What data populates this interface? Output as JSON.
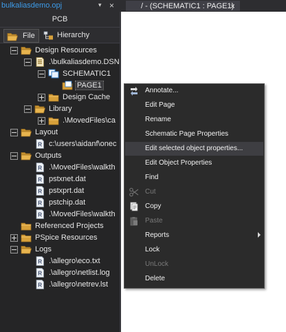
{
  "top": {
    "project_tab_title": "bulkaliasdemo.opj",
    "pin_icon": "▾",
    "close_icon": "×",
    "doc_tab_title": "/ - (SCHEMATIC1 : PAGE1)"
  },
  "panel": {
    "pcb_label": "PCB",
    "tabs": {
      "file": "File",
      "hierarchy": "Hierarchy"
    }
  },
  "tree": {
    "design_resources": "Design Resources",
    "dsn": ".\\bulkaliasdemo.DSN",
    "schematic1": "SCHEMATIC1",
    "page1": "PAGE1",
    "design_cache": "Design Cache",
    "library": "Library",
    "movedfiles_ca": ".\\MovedFiles\\ca",
    "layout": "Layout",
    "layout_path": "c:\\users\\aidanf\\onec",
    "outputs": "Outputs",
    "outputs_movedfiles_walkth": ".\\MovedFiles\\walkth",
    "pstxnet": "pstxnet.dat",
    "pstxprt": "pstxprt.dat",
    "pstchip": "pstchip.dat",
    "outputs_movedfiles_walkth2": ".\\MovedFiles\\walkth",
    "referenced_projects": "Referenced Projects",
    "pspice_resources": "PSpice Resources",
    "logs": "Logs",
    "eco": ".\\allegro\\eco.txt",
    "netlist": ".\\allegro\\netlist.log",
    "netrev": ".\\allegro\\netrev.lst"
  },
  "menu": {
    "annotate": "Annotate...",
    "edit_page": "Edit Page",
    "rename": "Rename",
    "schematic_page_properties": "Schematic Page Properties",
    "edit_selected_object_properties": "Edit selected object properties...",
    "edit_object_properties": "Edit Object Properties",
    "find": "Find",
    "cut": "Cut",
    "copy": "Copy",
    "paste": "Paste",
    "reports": "Reports",
    "lock": "Lock",
    "unlock": "UnLock",
    "delete": "Delete"
  },
  "colors": {
    "accent": "#3d9be9",
    "panel_bg": "#252526",
    "menu_bg": "#2b2b2b",
    "menu_highlight": "#3e3e42",
    "folder": "#d8a13b"
  }
}
